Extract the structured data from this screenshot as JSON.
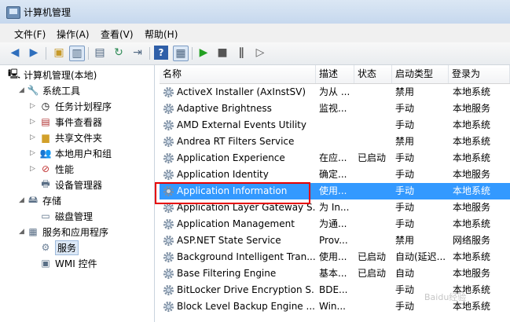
{
  "window": {
    "title": "计算机管理"
  },
  "menu": [
    "文件(F)",
    "操作(A)",
    "查看(V)",
    "帮助(H)"
  ],
  "tree": {
    "root": "计算机管理(本地)",
    "items": [
      {
        "label": "系统工具",
        "level": 1,
        "icon": "tools-icon"
      },
      {
        "label": "任务计划程序",
        "level": 2,
        "icon": "clock-icon"
      },
      {
        "label": "事件查看器",
        "level": 2,
        "icon": "event-viewer-icon"
      },
      {
        "label": "共享文件夹",
        "level": 2,
        "icon": "shared-folder-icon"
      },
      {
        "label": "本地用户和组",
        "level": 2,
        "icon": "users-icon"
      },
      {
        "label": "性能",
        "level": 2,
        "icon": "performance-icon"
      },
      {
        "label": "设备管理器",
        "level": 2,
        "icon": "device-manager-icon"
      },
      {
        "label": "存储",
        "level": 1,
        "icon": "storage-icon"
      },
      {
        "label": "磁盘管理",
        "level": 2,
        "icon": "disk-icon"
      },
      {
        "label": "服务和应用程序",
        "level": 1,
        "icon": "services-apps-icon"
      },
      {
        "label": "服务",
        "level": 2,
        "icon": "gear-icon",
        "selected": true
      },
      {
        "label": "WMI 控件",
        "level": 2,
        "icon": "wmi-icon"
      }
    ]
  },
  "columns": [
    "名称",
    "描述",
    "状态",
    "启动类型",
    "登录为"
  ],
  "services": [
    [
      "ActiveX Installer (AxInstSV)",
      "为从 ...",
      "",
      "禁用",
      "本地系统"
    ],
    [
      "Adaptive Brightness",
      "监视...",
      "",
      "手动",
      "本地服务"
    ],
    [
      "AMD External Events Utility",
      "",
      "",
      "手动",
      "本地系统"
    ],
    [
      "Andrea RT Filters Service",
      "",
      "",
      "禁用",
      "本地系统"
    ],
    [
      "Application Experience",
      "在应...",
      "已启动",
      "手动",
      "本地系统"
    ],
    [
      "Application Identity",
      "确定...",
      "",
      "手动",
      "本地服务"
    ],
    [
      "Application Information",
      "使用...",
      "",
      "手动",
      "本地系统"
    ],
    [
      "Application Layer Gateway S...",
      "为 In...",
      "",
      "手动",
      "本地服务"
    ],
    [
      "Application Management",
      "为通...",
      "",
      "手动",
      "本地系统"
    ],
    [
      "ASP.NET State Service",
      "Prov...",
      "",
      "禁用",
      "网络服务"
    ],
    [
      "Background Intelligent Tran...",
      "使用...",
      "已启动",
      "自动(延迟...",
      "本地系统"
    ],
    [
      "Base Filtering Engine",
      "基本...",
      "已启动",
      "自动",
      "本地服务"
    ],
    [
      "BitLocker Drive Encryption S...",
      "BDE...",
      "",
      "手动",
      "本地系统"
    ],
    [
      "Block Level Backup Engine ...",
      "Win...",
      "",
      "手动",
      "本地系统"
    ]
  ],
  "selected_index": 6
}
